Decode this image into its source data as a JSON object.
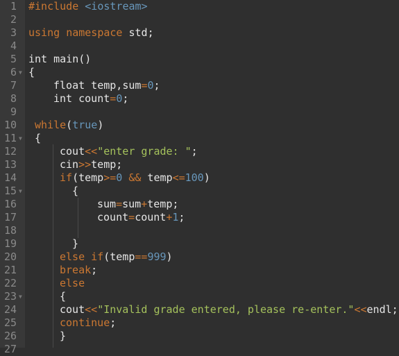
{
  "editor": {
    "language": "C++",
    "lines": [
      {
        "n": "1",
        "fold": false,
        "indent": 0,
        "tokens": [
          {
            "t": "#include",
            "c": "kw"
          },
          {
            "t": " "
          },
          {
            "t": "<iostream>",
            "c": "num"
          }
        ]
      },
      {
        "n": "2",
        "fold": false,
        "indent": 0,
        "tokens": []
      },
      {
        "n": "3",
        "fold": false,
        "indent": 0,
        "tokens": [
          {
            "t": "using",
            "c": "kw"
          },
          {
            "t": " "
          },
          {
            "t": "namespace",
            "c": "kw"
          },
          {
            "t": " std;"
          }
        ]
      },
      {
        "n": "4",
        "fold": false,
        "indent": 0,
        "tokens": []
      },
      {
        "n": "5",
        "fold": false,
        "indent": 0,
        "tokens": [
          {
            "t": "int main()"
          }
        ]
      },
      {
        "n": "6",
        "fold": true,
        "indent": 0,
        "tokens": [
          {
            "t": "{"
          }
        ]
      },
      {
        "n": "7",
        "fold": false,
        "indent": 4,
        "tokens": [
          {
            "t": "float temp,sum"
          },
          {
            "t": "=",
            "c": "op"
          },
          {
            "t": "0",
            "c": "num"
          },
          {
            "t": ";"
          }
        ]
      },
      {
        "n": "8",
        "fold": false,
        "indent": 4,
        "tokens": [
          {
            "t": "int count"
          },
          {
            "t": "=",
            "c": "op"
          },
          {
            "t": "0",
            "c": "num"
          },
          {
            "t": ";"
          }
        ]
      },
      {
        "n": "9",
        "fold": false,
        "indent": 0,
        "tokens": []
      },
      {
        "n": "10",
        "fold": false,
        "indent": 1,
        "tokens": [
          {
            "t": "while",
            "c": "kw"
          },
          {
            "t": "("
          },
          {
            "t": "true",
            "c": "num"
          },
          {
            "t": ")"
          }
        ]
      },
      {
        "n": "11",
        "fold": true,
        "indent": 1,
        "tokens": [
          {
            "t": "{"
          }
        ]
      },
      {
        "n": "12",
        "fold": false,
        "indent": 5,
        "tokens": [
          {
            "t": "cout"
          },
          {
            "t": "<<",
            "c": "op"
          },
          {
            "t": "\"enter grade: \"",
            "c": "str"
          },
          {
            "t": ";"
          }
        ]
      },
      {
        "n": "13",
        "fold": false,
        "indent": 5,
        "tokens": [
          {
            "t": "cin"
          },
          {
            "t": ">>",
            "c": "op"
          },
          {
            "t": "temp;"
          }
        ]
      },
      {
        "n": "14",
        "fold": false,
        "indent": 5,
        "tokens": [
          {
            "t": "if",
            "c": "kw"
          },
          {
            "t": "(temp"
          },
          {
            "t": ">=",
            "c": "op"
          },
          {
            "t": "0",
            "c": "num"
          },
          {
            "t": " "
          },
          {
            "t": "&&",
            "c": "op"
          },
          {
            "t": " temp"
          },
          {
            "t": "<=",
            "c": "op"
          },
          {
            "t": "100",
            "c": "num"
          },
          {
            "t": ")"
          }
        ]
      },
      {
        "n": "15",
        "fold": true,
        "indent": 7,
        "tokens": [
          {
            "t": "{"
          }
        ]
      },
      {
        "n": "16",
        "fold": false,
        "indent": 11,
        "tokens": [
          {
            "t": "sum"
          },
          {
            "t": "=",
            "c": "op"
          },
          {
            "t": "sum"
          },
          {
            "t": "+",
            "c": "op"
          },
          {
            "t": "temp;"
          }
        ]
      },
      {
        "n": "17",
        "fold": false,
        "indent": 11,
        "tokens": [
          {
            "t": "count"
          },
          {
            "t": "=",
            "c": "op"
          },
          {
            "t": "count"
          },
          {
            "t": "+",
            "c": "op"
          },
          {
            "t": "1",
            "c": "num"
          },
          {
            "t": ";"
          }
        ]
      },
      {
        "n": "18",
        "fold": false,
        "indent": 0,
        "tokens": []
      },
      {
        "n": "19",
        "fold": false,
        "indent": 7,
        "tokens": [
          {
            "t": "}"
          }
        ]
      },
      {
        "n": "20",
        "fold": false,
        "indent": 5,
        "tokens": [
          {
            "t": "else",
            "c": "kw"
          },
          {
            "t": " "
          },
          {
            "t": "if",
            "c": "kw"
          },
          {
            "t": "(temp"
          },
          {
            "t": "==",
            "c": "op"
          },
          {
            "t": "999",
            "c": "num"
          },
          {
            "t": ")"
          }
        ]
      },
      {
        "n": "21",
        "fold": false,
        "indent": 5,
        "tokens": [
          {
            "t": "break",
            "c": "kw"
          },
          {
            "t": ";"
          }
        ]
      },
      {
        "n": "22",
        "fold": false,
        "indent": 5,
        "tokens": [
          {
            "t": "else",
            "c": "kw"
          }
        ]
      },
      {
        "n": "23",
        "fold": true,
        "indent": 5,
        "tokens": [
          {
            "t": "{"
          }
        ]
      },
      {
        "n": "24",
        "fold": false,
        "indent": 5,
        "tokens": [
          {
            "t": "cout"
          },
          {
            "t": "<<",
            "c": "op"
          },
          {
            "t": "\"Invalid grade entered, please re-enter.\"",
            "c": "str"
          },
          {
            "t": "<<",
            "c": "op"
          },
          {
            "t": "endl;"
          }
        ]
      },
      {
        "n": "25",
        "fold": false,
        "indent": 5,
        "tokens": [
          {
            "t": "continue",
            "c": "kw"
          },
          {
            "t": ";"
          }
        ]
      },
      {
        "n": "26",
        "fold": false,
        "indent": 5,
        "tokens": [
          {
            "t": "}"
          }
        ]
      },
      {
        "n": "27",
        "fold": false,
        "indent": 0,
        "tokens": []
      }
    ]
  },
  "icons": {
    "fold": "fold-arrow-icon"
  },
  "colors": {
    "keyword": "#cc7832",
    "number": "#6897bb",
    "string": "#a5c25c",
    "text": "#e6e6e6",
    "background": "#2f2f2f",
    "gutter": "#383838",
    "line_number": "#8a8a8a"
  }
}
